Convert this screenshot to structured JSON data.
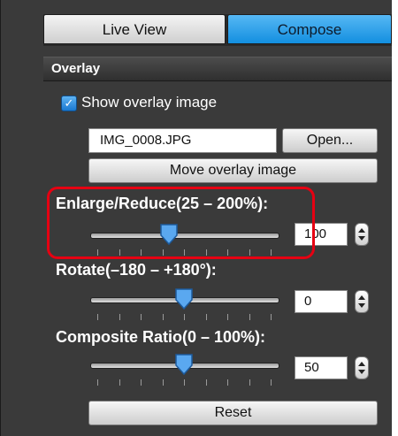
{
  "tabs": [
    {
      "label": "Live View",
      "selected": false
    },
    {
      "label": "Compose",
      "selected": true
    }
  ],
  "overlay": {
    "title": "Overlay",
    "show_overlay": {
      "label": "Show overlay image",
      "checked": true
    },
    "filename": "IMG_0008.JPG",
    "open_label": "Open...",
    "move_label": "Move overlay image",
    "reset_label": "Reset"
  },
  "controls": {
    "enlarge": {
      "label": "Enlarge/Reduce(25 – 200%):",
      "value": "100",
      "level": 0.42
    },
    "rotate": {
      "label": "Rotate(–180 – +180°):",
      "value": "0",
      "level": 0.5
    },
    "ratio": {
      "label": "Composite Ratio(0 – 100%):",
      "value": "50",
      "level": 0.5
    }
  },
  "colors": {
    "accent": "#138fe0",
    "highlight": "#e60012"
  },
  "icons": {
    "checkbox": "check-icon",
    "stepper": "stepper-arrows-icon",
    "slider_thumb": "slider-thumb-icon"
  }
}
